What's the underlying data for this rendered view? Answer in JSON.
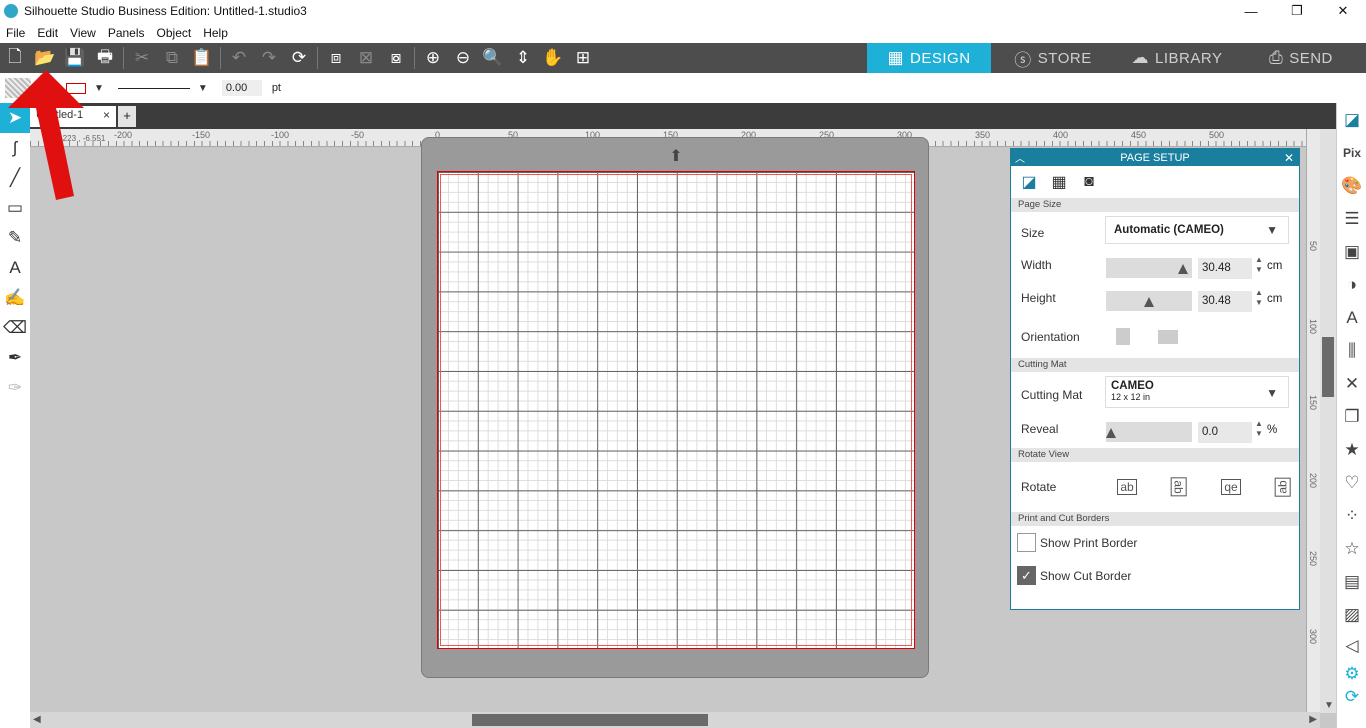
{
  "app": {
    "title": "Silhouette Studio Business Edition: Untitled-1.studio3"
  },
  "menu": [
    "File",
    "Edit",
    "View",
    "Panels",
    "Object",
    "Help"
  ],
  "toolbar_icons": [
    "new-file",
    "open-folder",
    "save",
    "print",
    "cut",
    "copy",
    "paste",
    "undo",
    "redo",
    "redraw",
    "group",
    "ungroup",
    "compound",
    "zoom-in",
    "zoom-out",
    "zoom-select",
    "pan-down",
    "hand",
    "fit-page"
  ],
  "nav": {
    "design": "DESIGN",
    "store": "STORE",
    "library": "LIBRARY",
    "send": "SEND"
  },
  "props": {
    "line_width": "0.00",
    "unit": "pt"
  },
  "tab": {
    "label": "Untitled-1",
    "close": "×",
    "add": "+"
  },
  "coords": "-223 , -6.551",
  "ruler_top": [
    "-200",
    "-150",
    "-100",
    "-50",
    "0",
    "50",
    "100",
    "150",
    "200",
    "250",
    "300",
    "350",
    "400",
    "450",
    "500"
  ],
  "ruler_right": [
    "50",
    "100",
    "150",
    "200",
    "250",
    "300"
  ],
  "page_setup": {
    "title": "PAGE SETUP",
    "sections": {
      "page_size": "Page Size",
      "cutting_mat": "Cutting Mat",
      "rotate_view": "Rotate View",
      "borders": "Print and Cut Borders"
    },
    "size": {
      "label": "Size",
      "value": "Automatic (CAMEO)"
    },
    "width": {
      "label": "Width",
      "value": "30.48",
      "unit": "cm",
      "level": 0.95
    },
    "height": {
      "label": "Height",
      "value": "30.48",
      "unit": "cm",
      "level": 0.5
    },
    "orientation": {
      "label": "Orientation"
    },
    "mat": {
      "label": "Cutting Mat",
      "value": "CAMEO",
      "sub": "12 x 12 in"
    },
    "reveal": {
      "label": "Reveal",
      "value": "0.0",
      "unit": "%",
      "level": 0
    },
    "rotate": {
      "label": "Rotate",
      "options": [
        "ab",
        "ab",
        "qe",
        "ab"
      ],
      "selected": 0
    },
    "print_border": {
      "label": "Show Print Border",
      "checked": false
    },
    "cut_border": {
      "label": "Show Cut Border",
      "checked": true
    }
  },
  "colors": {
    "accent": "#1fb0d8",
    "panel": "#1a7f9f",
    "toolbar": "#4d4d4d"
  }
}
